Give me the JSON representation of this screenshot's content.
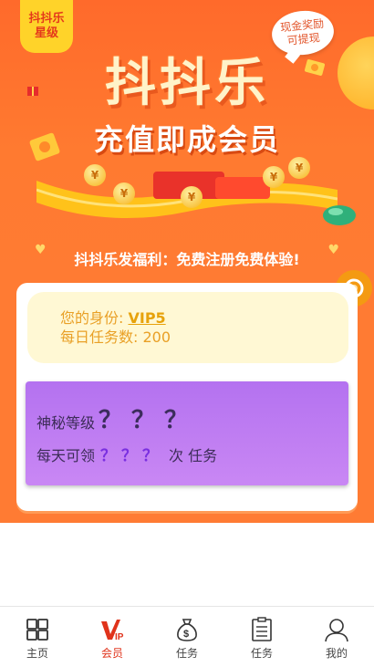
{
  "banner": {
    "corner_badge": [
      "抖抖乐",
      "星级"
    ],
    "bubble": [
      "现金奖励",
      "可提现"
    ],
    "title_main": "抖抖乐",
    "title_sub": "充值即成会员",
    "slogan": "抖抖乐发福利：免费注册免费体验!",
    "coin_symbol": "¥"
  },
  "identity": {
    "label": "您的身份: ",
    "vip": "VIP5",
    "tasks_label": "每日任务数: ",
    "tasks_value": "200"
  },
  "mystery_level": {
    "title": "神秘等级",
    "title_q": "？？？",
    "line_prefix": "每天可领",
    "line_q": "？？？",
    "line_suffix": "次 任务"
  },
  "tabbar": [
    {
      "label": "主页",
      "icon": "home-grid-icon"
    },
    {
      "label": "会员",
      "icon": "vip-icon",
      "active": true
    },
    {
      "label": "任务",
      "icon": "money-bag-icon"
    },
    {
      "label": "任务",
      "icon": "clipboard-icon"
    },
    {
      "label": "我的",
      "icon": "user-icon"
    }
  ],
  "colors": {
    "banner_orange": "#ff6a2b",
    "page_orange": "#ff7b33",
    "identity_bg": "#fff8d4",
    "identity_text": "#e9a026",
    "level_purple": "#b472f0",
    "tab_active": "#e0331b"
  }
}
